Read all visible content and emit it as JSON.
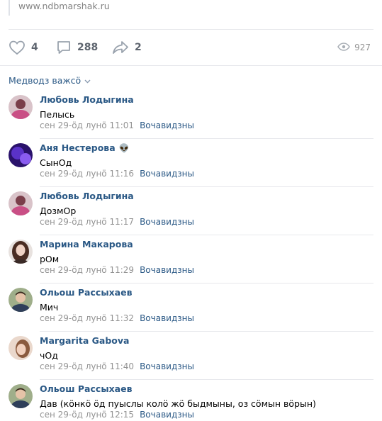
{
  "post": {
    "link": "www.ndbmarshak.ru",
    "likes": "4",
    "comments": "288",
    "shares": "2",
    "views": "927"
  },
  "sort_label": "Медводз важсö",
  "reply_label": "Вочавидзны",
  "comments": [
    {
      "author": "Любовь Лодыгина",
      "emoji": "",
      "text": "Пелысь",
      "time": "сен 29-öд лунö 11:01",
      "avatar_color": "#c9869b"
    },
    {
      "author": "Аня Нестерова",
      "emoji": "👽",
      "text": "СынОд",
      "time": "сен 29-öд лунö 11:16",
      "avatar_color": "#3b1f8f"
    },
    {
      "author": "Любовь Лодыгина",
      "emoji": "",
      "text": "ДозмОр",
      "time": "сен 29-öд лунö 11:17",
      "avatar_color": "#c9869b"
    },
    {
      "author": "Марина Макарова",
      "emoji": "",
      "text": "рОм",
      "time": "сен 29-öд лунö 11:29",
      "avatar_color": "#6b4a3e"
    },
    {
      "author": "Ольош Рассыхаев",
      "emoji": "",
      "text": "Мич",
      "time": "сен 29-öд лунö 11:32",
      "avatar_color": "#7f8f6b"
    },
    {
      "author": "Margarita Gabova",
      "emoji": "",
      "text": "чОд",
      "time": "сен 29-öд лунö 11:40",
      "avatar_color": "#c7a58e"
    },
    {
      "author": "Ольош Рассыхаев",
      "emoji": "",
      "text": "Дав (кöнкö öд пуыслы колö жö быдмыны, оз сöмын вöрын)",
      "time": "сен 29-öд лунö 12:15",
      "avatar_color": "#7f8f6b"
    }
  ]
}
